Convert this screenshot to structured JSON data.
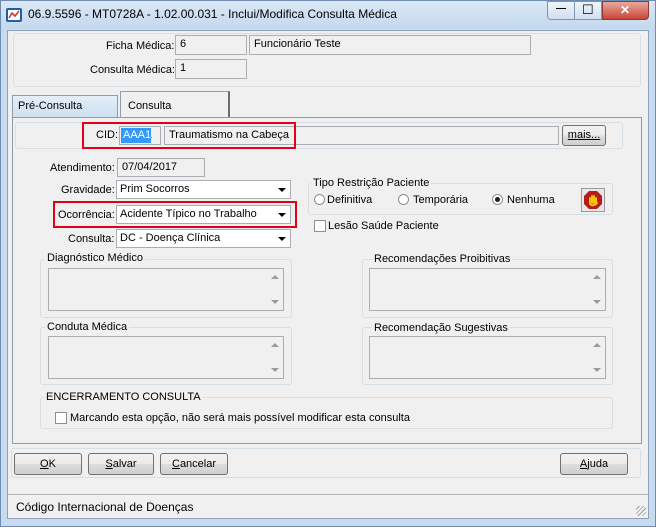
{
  "window": {
    "title": "06.9.5596 - MT0728A - 1.02.00.031 - Inclui/Modifica Consulta Médica",
    "min_glyph": "—",
    "max_glyph": "☐",
    "close_glyph": "✕"
  },
  "header": {
    "ficha_label": "Ficha Médica:",
    "ficha_number": "6",
    "ficha_name": "Funcionário Teste",
    "consulta_label": "Consulta Médica:",
    "consulta_number": "1"
  },
  "tabs": [
    {
      "label": "Pré-Consulta",
      "active": false
    },
    {
      "label": "Consulta",
      "active": true
    }
  ],
  "cid": {
    "label": "CID:",
    "code": "AAA1",
    "description": "Traumatismo na Cabeça",
    "more_button": "mais..."
  },
  "atendimento": {
    "label": "Atendimento:",
    "value": "07/04/2017"
  },
  "gravidade": {
    "label": "Gravidade:",
    "value": "Prim Socorros"
  },
  "ocorrencia": {
    "label": "Ocorrência:",
    "value": "Acidente Típico no Trabalho"
  },
  "consulta_tipo": {
    "label": "Consulta:",
    "value": "DC - Doença Clínica"
  },
  "restricao": {
    "title": "Tipo Restrição Paciente",
    "options": [
      "Definitiva",
      "Temporária",
      "Nenhuma"
    ],
    "selected": "Nenhuma"
  },
  "lesao": {
    "label": "Lesão Saúde Paciente"
  },
  "panels": {
    "diagnostico": "Diagnóstico Médico",
    "proibitivas": "Recomendações Proibitivas",
    "conduta": "Conduta Médica",
    "sugestivas": "Recomendação Sugestivas"
  },
  "encerramento": {
    "title": "ENCERRAMENTO CONSULTA",
    "checkbox_label": "Marcando esta opção, não será mais possível modificar esta consulta"
  },
  "buttons": {
    "ok": {
      "accel": "O",
      "rest": "K"
    },
    "salvar": {
      "accel": "S",
      "rest": "alvar"
    },
    "cancelar": {
      "accel": "C",
      "rest": "ancelar"
    },
    "ajuda": {
      "accel": "A",
      "rest": "juda"
    }
  },
  "status_bar": "Código Internacional de Doenças",
  "colors": {
    "highlight": "#e3001b",
    "selection": "#3399ff",
    "title_bg": "#c4d8ee"
  }
}
